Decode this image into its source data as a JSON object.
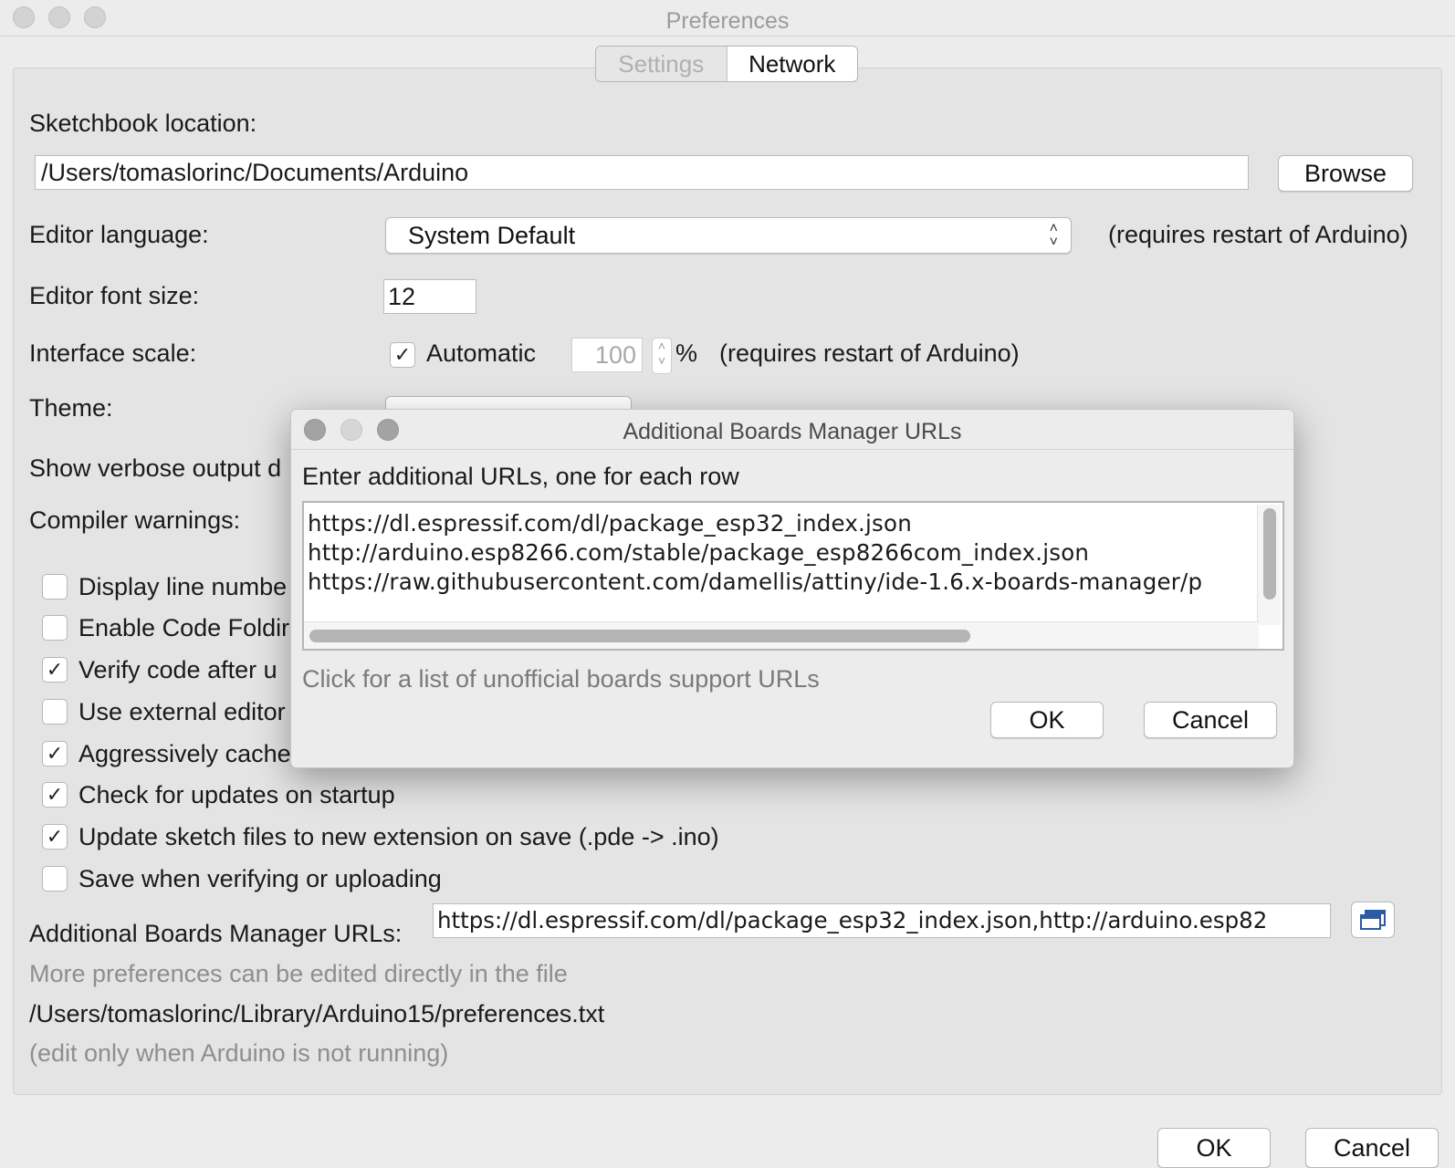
{
  "window": {
    "title": "Preferences"
  },
  "tabs": [
    {
      "label": "Settings",
      "active": false
    },
    {
      "label": "Network",
      "active": true
    }
  ],
  "settings": {
    "sketchbook_label": "Sketchbook location:",
    "sketchbook_path": "/Users/tomaslorinc/Documents/Arduino",
    "browse_label": "Browse",
    "editor_language_label": "Editor language:",
    "editor_language_value": "System Default",
    "restart_note": "(requires restart of Arduino)",
    "font_size_label": "Editor font size:",
    "font_size_value": "12",
    "interface_scale_label": "Interface scale:",
    "automatic_label": "Automatic",
    "scale_value": "100",
    "percent": "%",
    "restart_note_2": "(requires restart of Arduino)",
    "theme_label": "Theme:",
    "verbose_label": "Show verbose output d",
    "compiler_warnings_label": "Compiler warnings:",
    "checkboxes": [
      {
        "label": "Display line numbe",
        "checked": false
      },
      {
        "label": "Enable Code Foldir",
        "checked": false
      },
      {
        "label": "Verify code after u",
        "checked": true
      },
      {
        "label": "Use external editor",
        "checked": false
      },
      {
        "label": "Aggressively cache",
        "checked": true
      },
      {
        "label": "Check for updates on startup",
        "checked": true
      },
      {
        "label": "Update sketch files to new extension on save (.pde -> .ino)",
        "checked": true
      },
      {
        "label": "Save when verifying or uploading",
        "checked": false
      }
    ],
    "boards_urls_label": "Additional Boards Manager URLs:",
    "boards_urls_value": "https://dl.espressif.com/dl/package_esp32_index.json,http://arduino.esp82",
    "more_prefs_note": "More preferences can be edited directly in the file",
    "prefs_file_path": "/Users/tomaslorinc/Library/Arduino15/preferences.txt",
    "edit_note": "(edit only when Arduino is not running)"
  },
  "footer": {
    "ok_label": "OK",
    "cancel_label": "Cancel"
  },
  "dialog": {
    "title": "Additional Boards Manager URLs",
    "instruction": "Enter additional URLs, one for each row",
    "urls": [
      "https://dl.espressif.com/dl/package_esp32_index.json",
      "http://arduino.esp8266.com/stable/package_esp8266com_index.json",
      "https://raw.githubusercontent.com/damellis/attiny/ide-1.6.x-boards-manager/p"
    ],
    "unofficial_link": "Click for a list of unofficial boards support URLs",
    "ok_label": "OK",
    "cancel_label": "Cancel"
  },
  "colors": {
    "window_bg": "#ececec",
    "panel_bg": "#e4e4e4",
    "field_bg": "#ffffff",
    "muted_text": "#8e8e8e",
    "link_text": "#7a7a7a"
  }
}
